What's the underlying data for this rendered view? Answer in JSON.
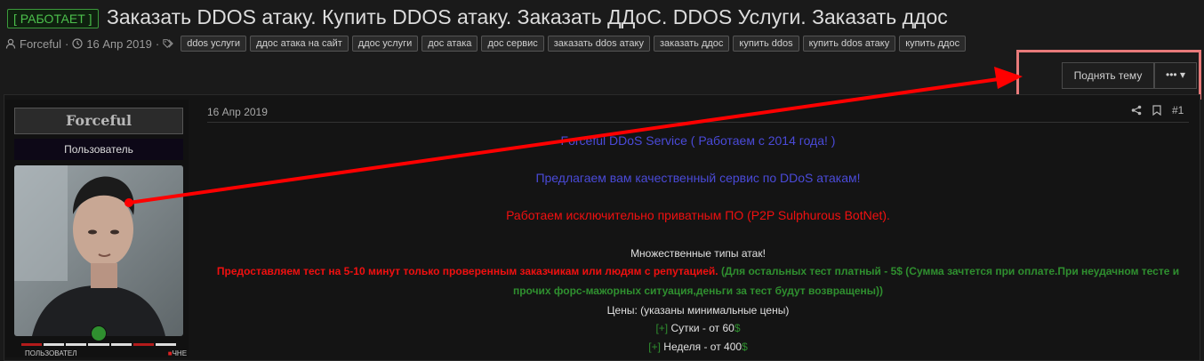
{
  "header": {
    "status_tag": "[ РАБОТАЕТ ]",
    "title": "Заказать DDOS атаку. Купить DDOS атаку. Заказать ДДоС. DDOS Услуги. Заказать ддос",
    "author": "Forceful",
    "date": "16 Апр 2019",
    "tags": [
      "ddos услуги",
      "ддос атака на сайт",
      "ддос услуги",
      "дос атака",
      "дос сервис",
      "заказать ddos атаку",
      "заказать ддос",
      "купить ddos",
      "купить ddos атаку",
      "купить ддос"
    ]
  },
  "actions": {
    "bump_label": "Поднять тему",
    "more_label": "•••"
  },
  "user": {
    "name": "Forceful",
    "title": "Пользователь",
    "userbar_text": "ПОЛЬЗОВАТЕЛ",
    "userbar_right": "ЧНЕ"
  },
  "post": {
    "date": "16 Апр 2019",
    "number": "#1",
    "line1": "Forceful DDoS Service ( Работаем с 2014 года! )",
    "line2": "Предлагаем вам качественный сервис по DDoS атакам!",
    "line3": "Работаем исключительно приватным ПО (P2P Sulphurous BotNet).",
    "line4": "Множественные типы атак!",
    "line5_red": "Предоставляем тест на 5-10 минут только проверенным заказчикам или людям с репутацией.",
    "line5_green": " (Для остальных тест платный - 5$ (Сумма зачтется при оплате.При неудачном тесте и",
    "line6_green": "прочих форс-мажорных ситуация,деньги за тест будут возвращены))",
    "line7": "Цены: (указаны минимальные цены)",
    "price1_prefix": "[+]",
    "price1_text": " Сутки - от 60",
    "price1_cur": "$",
    "price2_prefix": "[+]",
    "price2_text": " Неделя - от 400",
    "price2_cur": "$"
  },
  "colors": {
    "accent_green": "#3c9a3c",
    "highlight_box": "#e87a7a",
    "arrow": "#ff0000"
  }
}
